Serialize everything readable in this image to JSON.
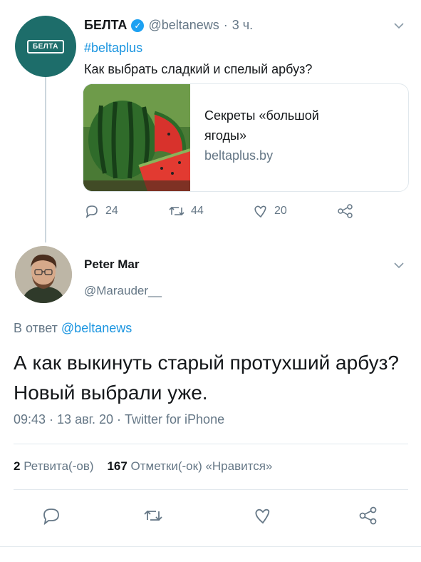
{
  "tweet": {
    "author_name": "БЕЛТА",
    "handle": "@beltanews",
    "time": "3 ч.",
    "hashtag": "#beltaplus",
    "text": "Как выбрать сладкий и спелый арбуз?",
    "avatar_logo_text": "БЕЛТА",
    "card": {
      "title_line1": "Секреты «большой",
      "title_line2": "ягоды»",
      "domain": "beltaplus.by"
    },
    "actions": {
      "replies": "24",
      "retweets": "44",
      "likes": "20"
    }
  },
  "reply": {
    "author_name": "Peter Mar",
    "handle": "@Marauder__",
    "reply_prefix": "В ответ",
    "reply_to": "@beltanews",
    "text": "А как выкинуть старый протухший арбуз? Новый выбрали уже.",
    "meta": "09:43 · 13 авг. 20 · Twitter for iPhone",
    "stats": {
      "retweets_count": "2",
      "retweets_label": "Ретвита(-ов)",
      "likes_count": "167",
      "likes_label": "Отметки(-ок) «Нравится»"
    }
  },
  "colors": {
    "accent": "#1b95e0",
    "muted": "#657786",
    "belta_green": "#1d6d6a"
  },
  "icons": [
    "chevron-down-icon",
    "verified-icon",
    "reply-icon",
    "retweet-icon",
    "like-icon",
    "share-icon"
  ]
}
